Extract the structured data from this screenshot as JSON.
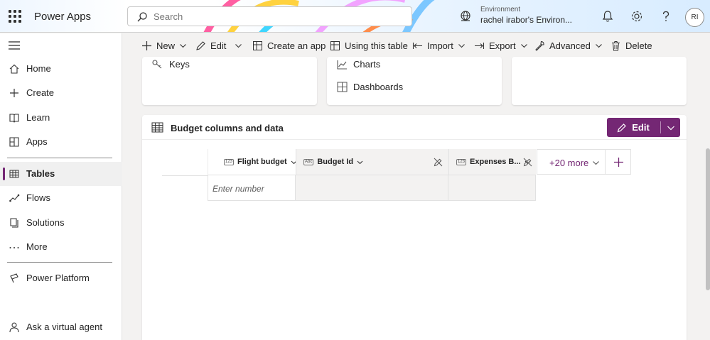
{
  "header": {
    "app_name": "Power Apps",
    "search_placeholder": "Search",
    "environment_label": "Environment",
    "environment_name": "rachel irabor's Environ...",
    "avatar_initials": "RI"
  },
  "nav": {
    "items": [
      {
        "label": "Home",
        "icon": "home-icon"
      },
      {
        "label": "Create",
        "icon": "plus-icon"
      },
      {
        "label": "Learn",
        "icon": "book-icon"
      },
      {
        "label": "Apps",
        "icon": "apps-icon"
      },
      {
        "label": "Tables",
        "icon": "table-icon",
        "active": true
      },
      {
        "label": "Flows",
        "icon": "flow-icon"
      },
      {
        "label": "Solutions",
        "icon": "solutions-icon"
      },
      {
        "label": "More",
        "icon": "more-icon"
      },
      {
        "label": "Power Platform",
        "icon": "power-platform-icon"
      },
      {
        "label": "Ask a virtual agent",
        "icon": "agent-icon"
      }
    ]
  },
  "commandbar": {
    "new": "New",
    "edit": "Edit",
    "create_app": "Create an app",
    "using_table": "Using this table",
    "import": "Import",
    "export": "Export",
    "advanced": "Advanced",
    "delete": "Delete"
  },
  "cards": {
    "keys": "Keys",
    "charts": "Charts",
    "dashboards": "Dashboards"
  },
  "budget": {
    "title": "Budget columns and data",
    "edit_label": "Edit",
    "columns": [
      {
        "label": "Flight budget",
        "type": "123"
      },
      {
        "label": "Budget Id",
        "type": "Abc"
      },
      {
        "label": "Expenses B...",
        "type": "123"
      }
    ],
    "more_label": "+20 more",
    "cell_placeholder": "Enter number"
  },
  "colors": {
    "accent": "#742774"
  }
}
